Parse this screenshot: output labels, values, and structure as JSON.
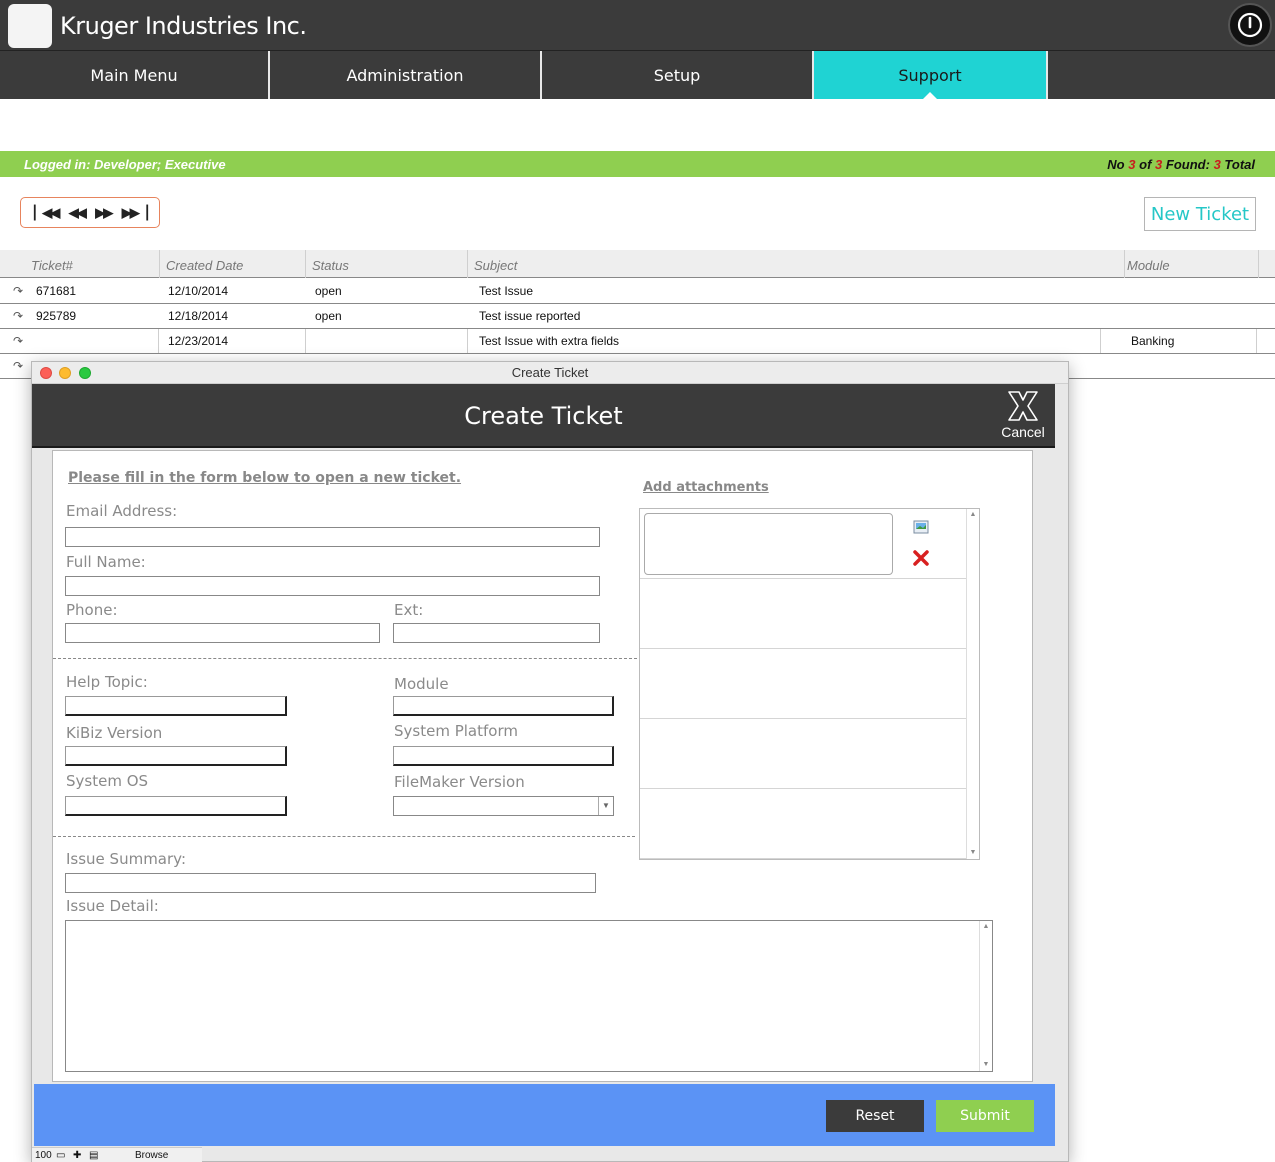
{
  "app": {
    "company_name": "Kruger Industries Inc.",
    "power_icon": "power-icon"
  },
  "nav": {
    "tabs": [
      {
        "label": "Main Menu",
        "active": false
      },
      {
        "label": "Administration",
        "active": false
      },
      {
        "label": "Setup",
        "active": false
      },
      {
        "label": "Support",
        "active": true
      }
    ]
  },
  "status": {
    "logged_in": "Logged in: Developer; Executive",
    "record_prefix": "No",
    "record_current": "3",
    "record_of": "of",
    "record_found": "3",
    "record_found_label": "Found:",
    "record_total": "3",
    "record_total_label": "Total"
  },
  "toolbar": {
    "first_icon": "first-record-icon",
    "prev_icon": "previous-record-icon",
    "next_icon": "next-record-icon",
    "last_icon": "last-record-icon",
    "new_ticket_label": "New Ticket"
  },
  "table": {
    "columns": [
      "Ticket#",
      "Created Date",
      "Status",
      "Subject",
      "Module"
    ],
    "rows": [
      {
        "ticket": "671681",
        "created": "12/10/2014",
        "status": "open",
        "subject": "Test Issue",
        "module": ""
      },
      {
        "ticket": "925789",
        "created": "12/18/2014",
        "status": "open",
        "subject": "Test issue reported",
        "module": ""
      },
      {
        "ticket": "",
        "created": "12/23/2014",
        "status": "",
        "subject": "Test Issue with extra fields",
        "module": "Banking"
      }
    ]
  },
  "dialog": {
    "window_title": "Create Ticket",
    "header_title": "Create Ticket",
    "cancel_label": "Cancel",
    "intro": "Please fill in the form below to open a new ticket.",
    "add_attachments": "Add attachments",
    "fields": {
      "email_label": "Email Address:",
      "full_name_label": "Full Name:",
      "phone_label": "Phone:",
      "ext_label": "Ext:",
      "help_topic_label": "Help Topic:",
      "module_label": "Module",
      "kibiz_version_label": "KiBiz Version",
      "system_platform_label": "System Platform",
      "system_os_label": "System OS",
      "filemaker_version_label": "FileMaker Version",
      "issue_summary_label": "Issue Summary:",
      "issue_detail_label": "Issue Detail:"
    },
    "reset_label": "Reset",
    "submit_label": "Submit"
  },
  "statusstrip": {
    "zoom": "100",
    "mode": "Browse"
  },
  "colors": {
    "header_bg": "#3b3b3b",
    "active_tab": "#1fd3d3",
    "status_green": "#8fcf50",
    "footer_blue": "#5b93f5",
    "record_red": "#c81e1e"
  }
}
